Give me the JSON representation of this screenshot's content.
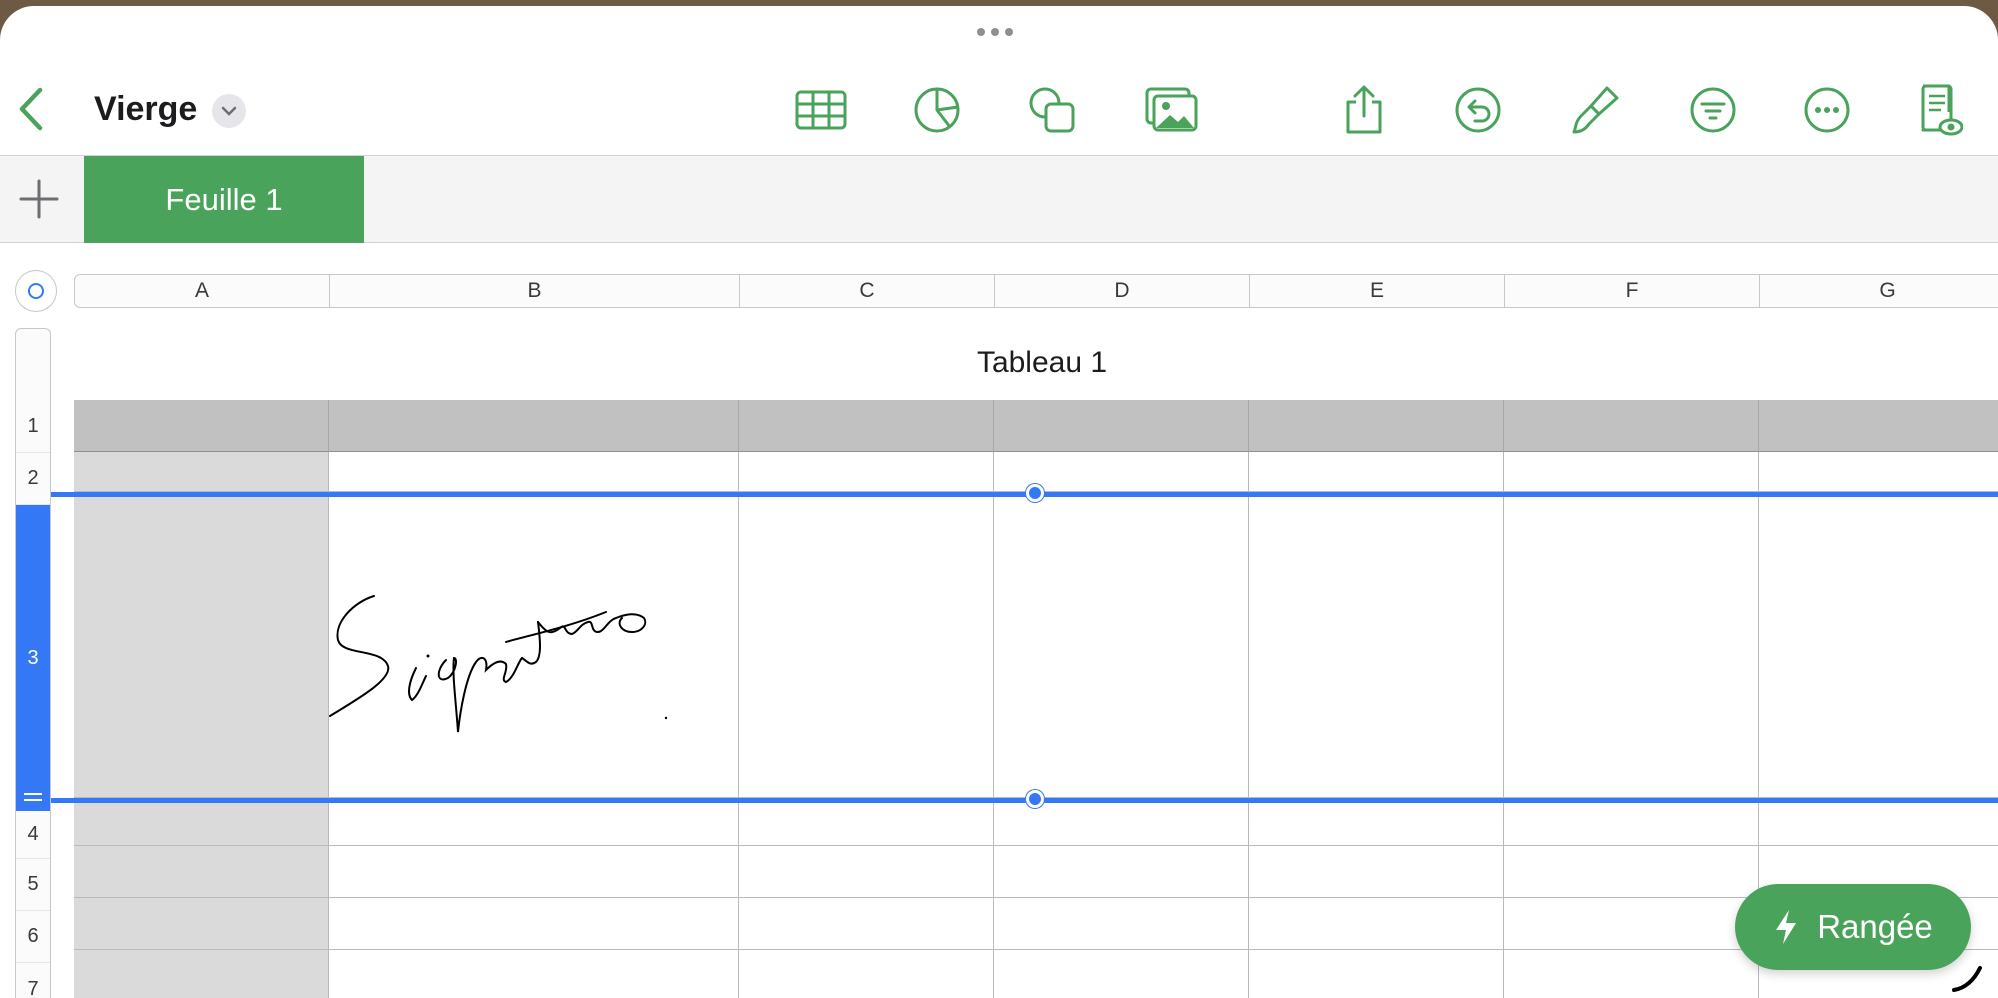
{
  "document": {
    "title": "Vierge"
  },
  "toolbar": {
    "back_icon": "chevron-left-icon",
    "title_menu_icon": "chevron-down-icon",
    "tools": [
      {
        "name": "insert-table-button",
        "icon": "table-icon"
      },
      {
        "name": "insert-chart-button",
        "icon": "chart-icon"
      },
      {
        "name": "insert-shape-button",
        "icon": "shapes-icon"
      },
      {
        "name": "insert-media-button",
        "icon": "photo-icon"
      },
      {
        "name": "share-button",
        "icon": "share-icon"
      },
      {
        "name": "undo-button",
        "icon": "undo-icon"
      },
      {
        "name": "format-button",
        "icon": "paintbrush-icon"
      },
      {
        "name": "filter-button",
        "icon": "filter-icon"
      },
      {
        "name": "more-button",
        "icon": "more-icon"
      },
      {
        "name": "reading-view-button",
        "icon": "document-eye-icon"
      }
    ]
  },
  "sheets": {
    "add_icon": "plus-icon",
    "tabs": [
      {
        "label": "Feuille 1",
        "active": true
      }
    ]
  },
  "columns": [
    "A",
    "B",
    "C",
    "D",
    "E",
    "F",
    "G"
  ],
  "rows": [
    "1",
    "2",
    "3",
    "4",
    "5",
    "6",
    "7"
  ],
  "selected_row": "3",
  "table": {
    "title": "Tableau 1",
    "signature_drawing": "Signature"
  },
  "fab": {
    "label": "Rangée",
    "icon": "bolt-icon"
  },
  "colors": {
    "accent": "#4aa35a",
    "selection": "#3478f6",
    "header_row": "#c0c1c0",
    "header_col": "#dadada"
  }
}
